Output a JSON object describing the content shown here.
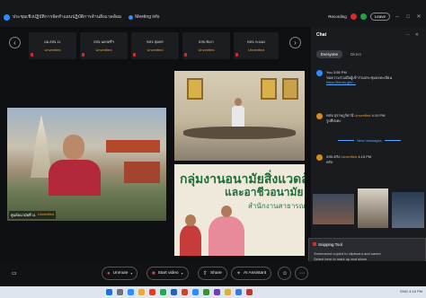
{
  "window": {
    "title": "ประชุมเชิงปฏิบัติการจัดทำแผนปฏิบัติการด้านสิ่งแวดล้อม",
    "meeting_info": "Meeting info",
    "recording": "Recording",
    "leave": "Leave"
  },
  "strip": {
    "tiles": [
      {
        "name": "ผอ.สสจ.11",
        "status": "Unverified"
      },
      {
        "name": "สสจ.นครศรีฯ",
        "status": "Unverified"
      },
      {
        "name": "ทสจ.ชุมพร",
        "status": "Unverified"
      },
      {
        "name": "สสจ.พังงา",
        "status": "Unverified"
      },
      {
        "name": "ทสจ.ระนอง",
        "status": "Unverified"
      }
    ]
  },
  "videos": {
    "main_label": "ศูนย์อนามัยที่ 11",
    "main_status": "Unverified",
    "banner_line1": "กลุ่มงานอนามัยสิ่งแวดล้อม",
    "banner_line2": "และอาชีวอนามัย",
    "banner_line3": "สำนักงานสาธารณสุขจังหวัด"
  },
  "chat": {
    "title": "Chat",
    "controls": "⋯ ✕",
    "tabs": [
      "Everyone",
      "Direct"
    ],
    "messages": [
      {
        "sender": "You",
        "time": "3:55 PM",
        "text": "ขอความร่วมมือผู้เข้าร่วมประชุมลงทะเบียน",
        "link": "https://forms.gle/..."
      },
      {
        "sender": "ทสจ.สุราษฎร์ธานี",
        "status": "Unverified",
        "time": "4:10 PM",
        "text": "รูปที่ส่งค่ะ"
      },
      {
        "sender": "สสจ.ตรัง",
        "status": "Unverified",
        "time": "4:15 PM",
        "text": "ครับ"
      }
    ],
    "new_messages": "New messages"
  },
  "snipping": {
    "title": "Snipping Tool",
    "body": "Screenshot copied to clipboard and saved",
    "hint": "Select here to mark up and share"
  },
  "toolbar": {
    "unmute": "Unmute",
    "start_video": "Start video",
    "share": "Share",
    "ai_assistant": "AI Assistant"
  },
  "taskbar": {
    "tray": "ENG 4:16 PM"
  }
}
